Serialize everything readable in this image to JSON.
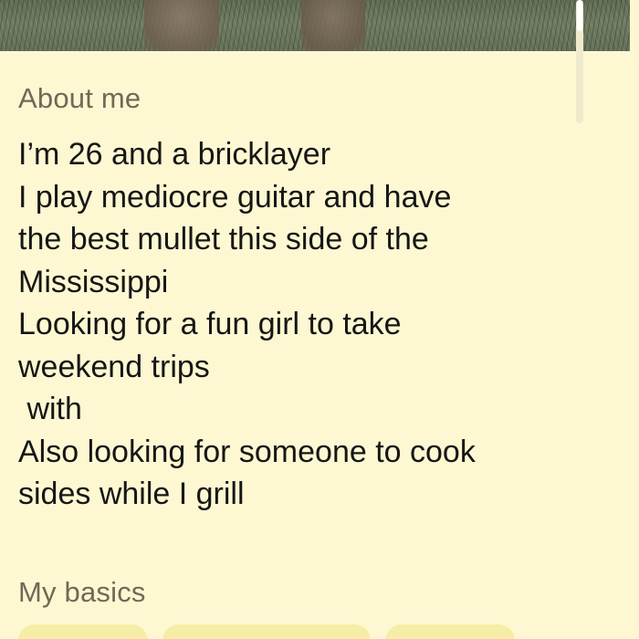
{
  "about": {
    "title": "About me",
    "lines": [
      "I’m 26 and a bricklayer",
      "I play mediocre guitar and have",
      "the best mullet this side of the",
      "Mississippi",
      "Looking for a fun girl to take",
      "weekend trips",
      " with",
      "Also looking for someone to cook",
      "sides while I grill"
    ]
  },
  "basics": {
    "title": "My basics"
  },
  "colors": {
    "background": "#fdf8d2",
    "section_title": "#6e6a57",
    "body_text": "#161616",
    "chip": "#f6eda6"
  }
}
